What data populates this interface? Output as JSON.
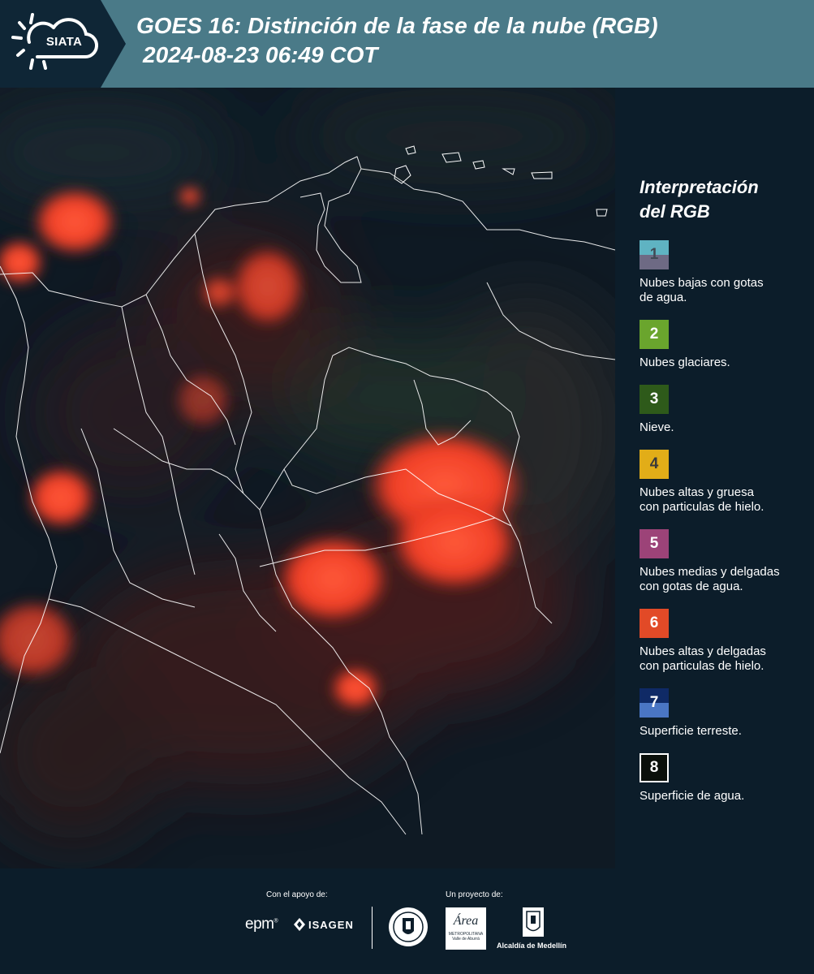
{
  "header": {
    "logo_text": "SIATA",
    "title_line1": "GOES 16: Distinción de la fase de la nube (RGB)",
    "title_line2": "2024-08-23 06:49 COT"
  },
  "legend": {
    "title_line1": "Interpretación",
    "title_line2": "del RGB",
    "items": [
      {
        "number": "1",
        "label_line1": "Nubes bajas con gotas",
        "label_line2": "de agua.",
        "color_top": "#5fb3c2",
        "color_bottom": "#6e6a84",
        "text_color": "#404a55"
      },
      {
        "number": "2",
        "label_line1": "Nubes glaciares.",
        "label_line2": "",
        "color_top": "#6aa52d",
        "color_bottom": "#6aa52d",
        "text_color": "#ffffff"
      },
      {
        "number": "3",
        "label_line1": "Nieve.",
        "label_line2": "",
        "color_top": "#2e5a1a",
        "color_bottom": "#2e5a1a",
        "text_color": "#ffffff"
      },
      {
        "number": "4",
        "label_line1": "Nubes altas y gruesa",
        "label_line2": "con particulas de hielo.",
        "color_top": "#e2ad18",
        "color_bottom": "#e2ad18",
        "text_color": "#3a3a3a"
      },
      {
        "number": "5",
        "label_line1": "Nubes medias y delgadas",
        "label_line2": "con gotas de agua.",
        "color_top": "#9c4378",
        "color_bottom": "#9c4378",
        "text_color": "#ffffff"
      },
      {
        "number": "6",
        "label_line1": "Nubes altas y delgadas",
        "label_line2": "con particulas de hielo.",
        "color_top": "#e24a27",
        "color_bottom": "#e24a27",
        "text_color": "#ffffff"
      },
      {
        "number": "7",
        "label_line1": "Superficie terreste.",
        "label_line2": "",
        "color_top": "#0f2a66",
        "color_bottom": "#4a76c4",
        "text_color": "#ffffff"
      },
      {
        "number": "8",
        "label_line1": "Superficie de agua.",
        "label_line2": "",
        "color_top": "#0a0f0a",
        "color_bottom": "#0a0f0a",
        "text_color": "#ffffff"
      }
    ]
  },
  "footer": {
    "support_label": "Con el apoyo de:",
    "project_label": "Un proyecto de:",
    "epm": "epm",
    "isagen": "ISAGEN",
    "area_name": "Área",
    "area_sub1": "METROPOLITANA",
    "area_sub2": "Valle de Aburrá",
    "alcaldia": "Alcaldía de Medellín"
  }
}
